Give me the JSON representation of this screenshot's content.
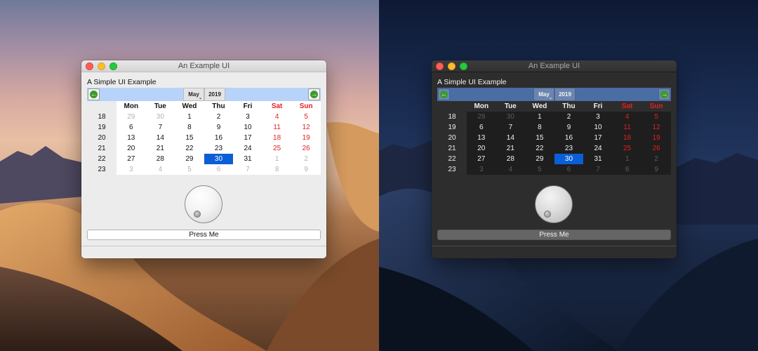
{
  "desktop": {
    "left_wallpaper": "mojave-day",
    "right_wallpaper": "mojave-night"
  },
  "window": {
    "title": "An Example UI",
    "heading": "A Simple UI Example",
    "button_label": "Press Me"
  },
  "calendar": {
    "month": "May",
    "year": "2019",
    "prev_icon": "arrow-left-circle-icon",
    "next_icon": "arrow-right-circle-icon",
    "weekdays": [
      "Mon",
      "Tue",
      "Wed",
      "Thu",
      "Fri",
      "Sat",
      "Sun"
    ],
    "weekend_color": "#e51f1f",
    "selected_color": "#0a5fd6",
    "weeks": [
      {
        "num": "18",
        "days": [
          {
            "d": "29",
            "o": true
          },
          {
            "d": "30",
            "o": true
          },
          {
            "d": "1"
          },
          {
            "d": "2"
          },
          {
            "d": "3"
          },
          {
            "d": "4"
          },
          {
            "d": "5"
          }
        ]
      },
      {
        "num": "19",
        "days": [
          {
            "d": "6"
          },
          {
            "d": "7"
          },
          {
            "d": "8"
          },
          {
            "d": "9"
          },
          {
            "d": "10"
          },
          {
            "d": "11"
          },
          {
            "d": "12"
          }
        ]
      },
      {
        "num": "20",
        "days": [
          {
            "d": "13"
          },
          {
            "d": "14"
          },
          {
            "d": "15"
          },
          {
            "d": "16"
          },
          {
            "d": "17"
          },
          {
            "d": "18"
          },
          {
            "d": "19"
          }
        ]
      },
      {
        "num": "21",
        "days": [
          {
            "d": "20"
          },
          {
            "d": "21"
          },
          {
            "d": "22"
          },
          {
            "d": "23"
          },
          {
            "d": "24"
          },
          {
            "d": "25"
          },
          {
            "d": "26"
          }
        ]
      },
      {
        "num": "22",
        "days": [
          {
            "d": "27"
          },
          {
            "d": "28"
          },
          {
            "d": "29"
          },
          {
            "d": "30",
            "s": true
          },
          {
            "d": "31"
          },
          {
            "d": "1",
            "o": true
          },
          {
            "d": "2",
            "o": true
          }
        ]
      },
      {
        "num": "23",
        "days": [
          {
            "d": "3",
            "o": true
          },
          {
            "d": "4",
            "o": true
          },
          {
            "d": "5",
            "o": true
          },
          {
            "d": "6",
            "o": true
          },
          {
            "d": "7",
            "o": true
          },
          {
            "d": "8",
            "o": true
          },
          {
            "d": "9",
            "o": true
          }
        ]
      }
    ]
  }
}
